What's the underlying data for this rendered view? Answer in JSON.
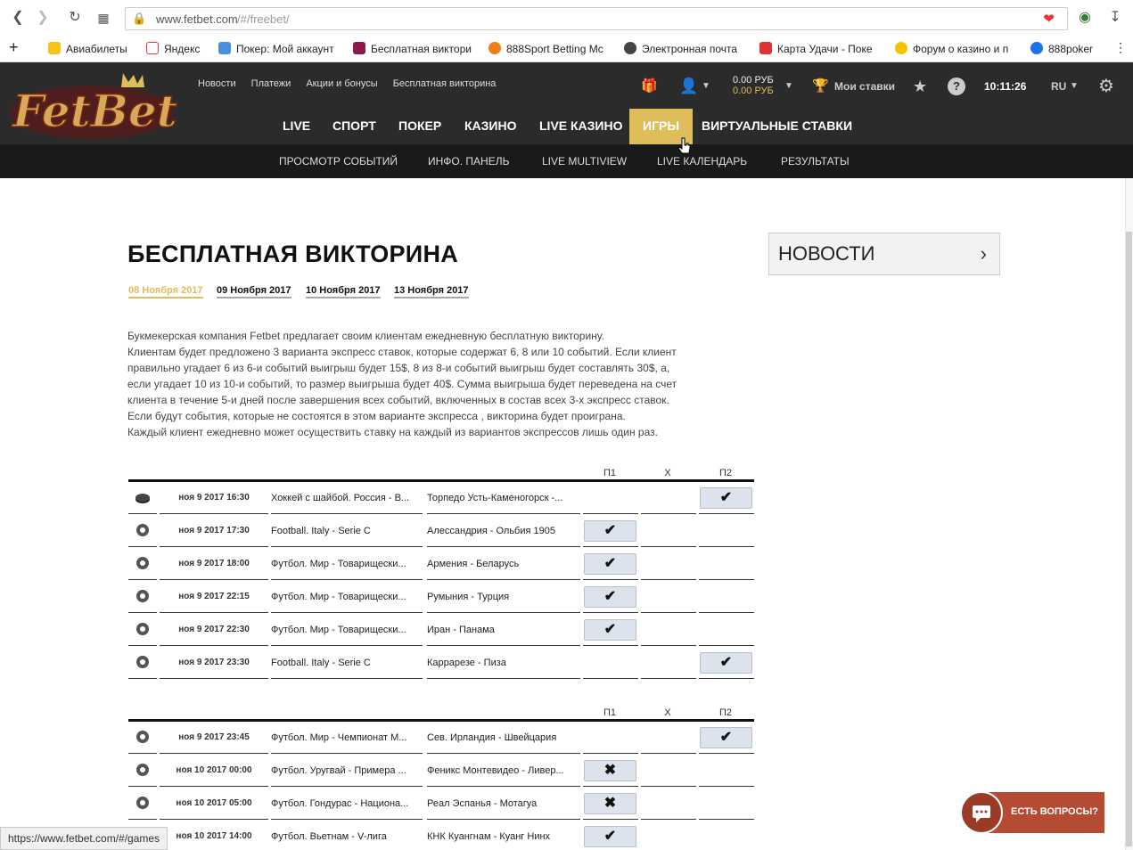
{
  "browser": {
    "url_host": "www.fetbet.com",
    "url_path": "/#/freebet/",
    "bookmarks": [
      "Авиабилеты",
      "Яндекс",
      "Покер: Мой аккаунт",
      "Бесплатная викторина",
      "888Sport Betting Mc",
      "Электронная почта",
      "Карта Удачи - Поке",
      "Форум о казино и п",
      "888poker"
    ],
    "status_url": "https://www.fetbet.com/#/games"
  },
  "header": {
    "logo_text": "FetBet",
    "top_links": [
      "Новости",
      "Платежи",
      "Акции и бонусы",
      "Бесплатная викторина"
    ],
    "balance_main": "0.00 РУБ",
    "balance_bonus": "0.00 РУБ",
    "my_bets": "Мои ставки",
    "time": "10:11:26",
    "lang": "RU"
  },
  "main_nav": [
    "LIVE",
    "СПОРТ",
    "ПОКЕР",
    "КАЗИНО",
    "LIVE КАЗИНО",
    "ИГРЫ",
    "ВИРТУАЛЬНЫЕ СТАВКИ"
  ],
  "sub_nav": [
    "ПРОСМОТР СОБЫТИЙ",
    "ИНФО. ПАНЕЛЬ",
    "LIVE MULTIVIEW",
    "LIVE КАЛЕНДАРЬ",
    "РЕЗУЛЬТАТЫ"
  ],
  "page": {
    "title": "БЕСПЛАТНАЯ ВИКТОРИНА",
    "dates": [
      "08 Ноября 2017",
      "09 Ноября 2017",
      "10 Ноября 2017",
      "13 Ноября 2017"
    ],
    "description": [
      "Букмекерская компания Fetbet предлагает своим клиентам ежедневную бесплатную викторину.",
      "Клиентам будет предложено 3 варианта экспресс ставок, которые содержат 6, 8 или 10 событий. Если клиент",
      "правильно угадает 6 из 6-и событий выигрыш будет 15$, 8 из 8-и событий выигрыш будет составлять 30$, а,",
      "если угадает 10 из 10-и событий, то размер выигрыша будет 40$. Сумма выигрыша будет переведена на счет",
      "клиента в течение 5-и дней после завершения всех событий, включенных в состав всех 3-х экспресс ставок.",
      "Если будут события, которые не состоятся в этом варианте экспресса , викторина будет проиграна.",
      "Каждый клиент ежедневно может осуществить ставку на каждый из вариантов экспрессов лишь один раз."
    ],
    "col_headers": [
      "П1",
      "Х",
      "П2"
    ],
    "table1": [
      {
        "sport": "hockey",
        "date": "ноя 9 2017 16:30",
        "league": "Хоккей с шайбой. Россия - В...",
        "match": "Торпедо Усть-Каменогорск -...",
        "pick": "p2",
        "mark": "✔"
      },
      {
        "sport": "football",
        "date": "ноя 9 2017 17:30",
        "league": "Football. Italy - Serie C",
        "match": "Алессандрия - Ольбия 1905",
        "pick": "p1",
        "mark": "✔"
      },
      {
        "sport": "football",
        "date": "ноя 9 2017 18:00",
        "league": "Футбол. Мир - Товарищески...",
        "match": "Армения - Беларусь",
        "pick": "p1",
        "mark": "✔"
      },
      {
        "sport": "football",
        "date": "ноя 9 2017 22:15",
        "league": "Футбол. Мир - Товарищески...",
        "match": "Румыния - Турция",
        "pick": "p1",
        "mark": "✔"
      },
      {
        "sport": "football",
        "date": "ноя 9 2017 22:30",
        "league": "Футбол. Мир - Товарищески...",
        "match": "Иран - Панама",
        "pick": "p1",
        "mark": "✔"
      },
      {
        "sport": "football",
        "date": "ноя 9 2017 23:30",
        "league": "Football. Italy - Serie C",
        "match": "Каррарезе - Пиза",
        "pick": "p2",
        "mark": "✔"
      }
    ],
    "table2": [
      {
        "sport": "football",
        "date": "ноя 9 2017 23:45",
        "league": "Футбол. Мир - Чемпионат М...",
        "match": "Сев. Ирландия - Швейцария",
        "pick": "p2",
        "mark": "✔"
      },
      {
        "sport": "football",
        "date": "ноя 10 2017 00:00",
        "league": "Футбол. Уругвай - Примера ...",
        "match": "Феникс Монтевидео - Ливер...",
        "pick": "p1",
        "mark": "✖"
      },
      {
        "sport": "football",
        "date": "ноя 10 2017 05:00",
        "league": "Футбол. Гондурас - Национа...",
        "match": "Реал Эспанья - Мотагуа",
        "pick": "p1",
        "mark": "✖"
      },
      {
        "sport": "football",
        "date": "ноя 10 2017 14:00",
        "league": "Футбол. Вьетнам - V-лига",
        "match": "КНК Куангнам - Куанг Нинх",
        "pick": "p1",
        "mark": "✔"
      }
    ],
    "news_label": "НОВОСТИ",
    "chat_label": "ЕСТЬ ВОПРОСЫ?"
  },
  "colors": {
    "accent": "#e0bd5b",
    "header_bg": "#2b2b2b",
    "subnav_bg": "#1a1a1a",
    "chat": "#b64b33"
  }
}
